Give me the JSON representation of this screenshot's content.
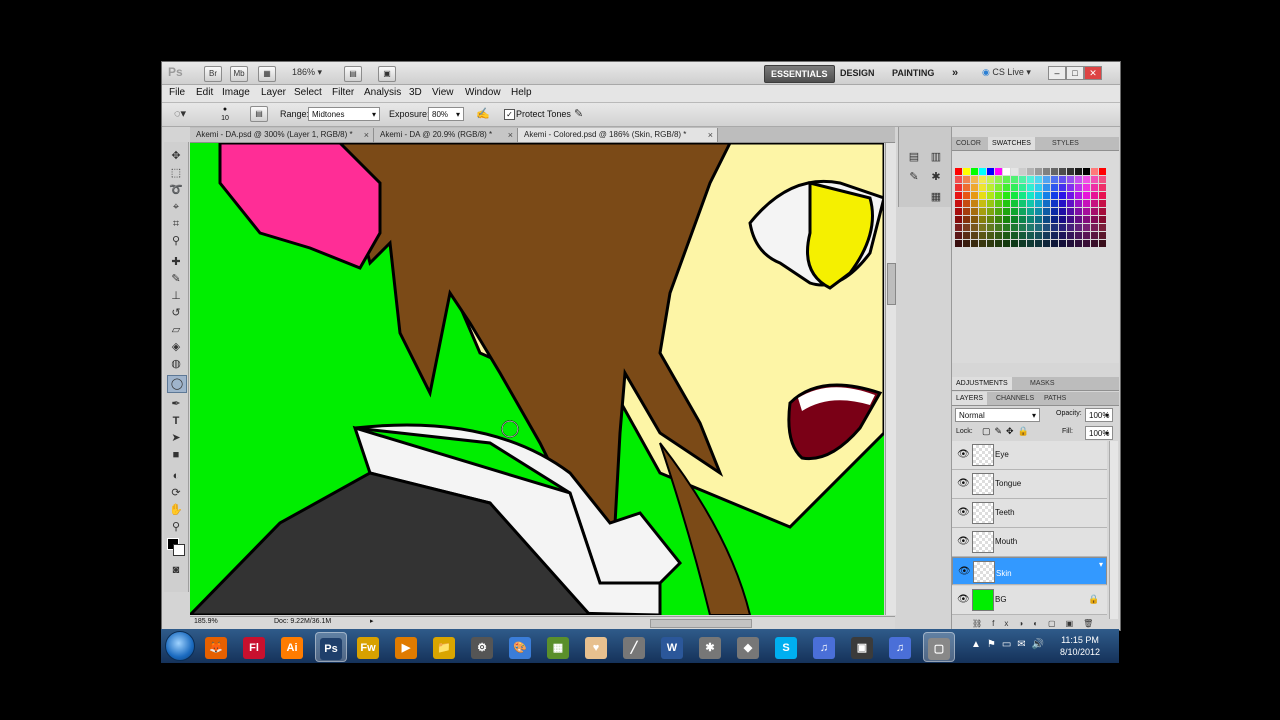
{
  "appbar": {
    "logo": "Ps",
    "zoom_value": "186%",
    "workspaces": [
      "ESSENTIALS",
      "DESIGN",
      "PAINTING"
    ],
    "more_label": "»",
    "cslive_label": "CS Live"
  },
  "menubar": {
    "items": [
      "File",
      "Edit",
      "Image",
      "Layer",
      "Select",
      "Filter",
      "Analysis",
      "3D",
      "View",
      "Window",
      "Help"
    ]
  },
  "options": {
    "brush_size": "10",
    "range_label": "Range:",
    "range_value": "Midtones",
    "exposure_label": "Exposure:",
    "exposure_value": "80%",
    "protect_tones_label": "Protect Tones",
    "protect_tones_checked": true
  },
  "doc_tabs": [
    {
      "label": "Akemi - DA.psd @ 300% (Layer 1, RGB/8) *",
      "close": "×"
    },
    {
      "label": "Akemi - DA @ 20.9% (RGB/8) *",
      "close": "×"
    },
    {
      "label": "Akemi - Colored.psd @ 186% (Skin, RGB/8) *",
      "close": "×"
    }
  ],
  "status": {
    "zoom": "185.9%",
    "doc_info": "Doc: 9.22M/36.1M"
  },
  "panels": {
    "color_tabs": [
      "COLOR",
      "SWATCHES",
      "STYLES"
    ],
    "adjust_tabs": [
      "ADJUSTMENTS",
      "MASKS"
    ],
    "layer_tabs": [
      "LAYERS",
      "CHANNELS",
      "PATHS"
    ],
    "blend_mode": "Normal",
    "opacity_label": "Opacity:",
    "opacity_value": "100%",
    "lock_label": "Lock:",
    "fill_label": "Fill:",
    "fill_value": "100%"
  },
  "layers": [
    {
      "name": "Eye",
      "selected": false
    },
    {
      "name": "Tongue",
      "selected": false
    },
    {
      "name": "Teeth",
      "selected": false
    },
    {
      "name": "Mouth",
      "selected": false
    },
    {
      "name": "Skin",
      "selected": true
    },
    {
      "name": "BG",
      "selected": false
    }
  ],
  "taskbar": {
    "apps": [
      "firefox-icon",
      "flash-icon",
      "illustrator-icon",
      "photoshop-icon",
      "fireworks-icon",
      "media-player-icon",
      "explorer-icon",
      "steam-icon",
      "paint-icon",
      "minecraft-icon",
      "heart-icon",
      "pen-icon",
      "word-icon",
      "app-icon",
      "app-icon",
      "skype-icon",
      "itunes-icon",
      "app-icon",
      "itunes-icon",
      "app-icon"
    ],
    "app_glyphs": [
      "🦊",
      "Fl",
      "Ai",
      "Ps",
      "Fw",
      "▶",
      "📁",
      "⚙",
      "🎨",
      "▦",
      "♥",
      "╱",
      "W",
      "✱",
      "◆",
      "S",
      "♫",
      "▣",
      "♫",
      "▢"
    ],
    "time": "11:15 PM",
    "date": "8/10/2012"
  },
  "colors": {
    "canvas_bg": "#00ee00",
    "hair": "#7b4a17",
    "skin": "#fdf5a6",
    "bow": "#ff2d96",
    "eye": "#f5f000",
    "mouth": "#7a0016",
    "selection": "#3399ff"
  }
}
